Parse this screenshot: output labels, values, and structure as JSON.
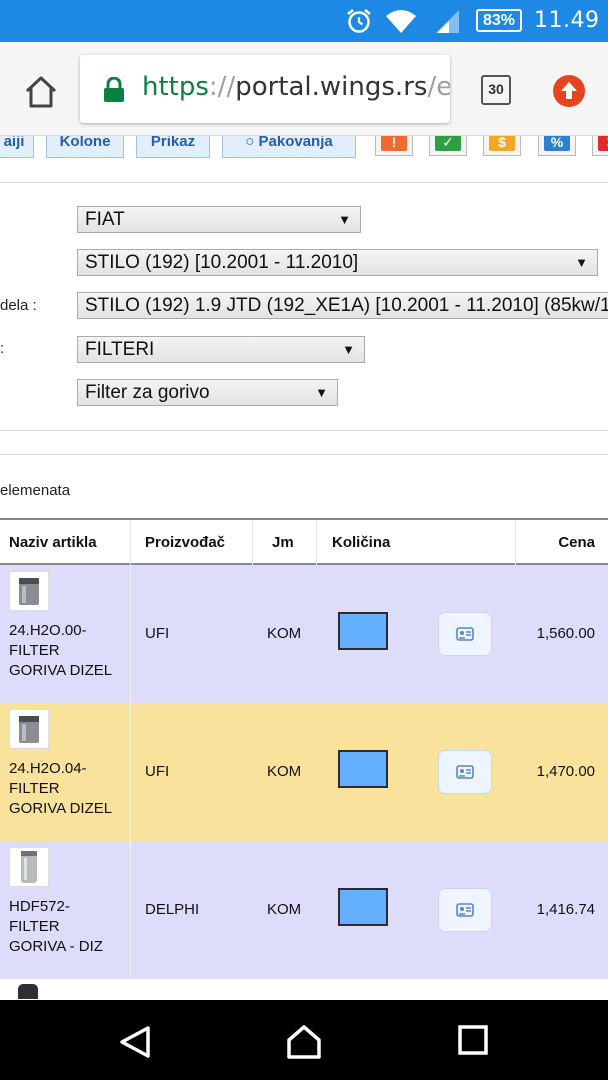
{
  "status_bar": {
    "battery": "83%",
    "time": "11.49",
    "icons": [
      "alarm-icon",
      "wifi-icon",
      "signal-icon",
      "battery-icon"
    ]
  },
  "browser": {
    "url_scheme": "https",
    "url_sep": "://",
    "url_host": "portal.wings.rs",
    "url_path": "/e",
    "tab_count": "30"
  },
  "toolbar": {
    "buttons": [
      "aiji",
      "Kolone",
      "Prikaz",
      "Pakovanja"
    ],
    "icon_buttons": [
      {
        "name": "alert",
        "glyph": "!",
        "color": "#f26a2e"
      },
      {
        "name": "check",
        "glyph": "✓",
        "color": "#2ea043"
      },
      {
        "name": "dollar",
        "glyph": "$",
        "color": "#f5a623"
      },
      {
        "name": "percent",
        "glyph": "%",
        "color": "#2f7fd1"
      },
      {
        "name": "close",
        "glyph": "✕",
        "color": "#e32b2b"
      }
    ]
  },
  "filters": {
    "labels": {
      "model_detail": "dela :",
      "group": ":"
    },
    "brand": "FIAT",
    "model": "STILO (192) [10.2001 - 11.2010]",
    "model_detail": "STILO (192) 1.9 JTD (192_XE1A) [10.2001 - 11.2010] (85kw/1",
    "group": "FILTERI",
    "subgroup": "Filter za gorivo"
  },
  "list": {
    "count_text": "elemenata",
    "headers": {
      "name": "Naziv artikla",
      "manufacturer": "Proizvođač",
      "unit": "Jm",
      "quantity": "Količina",
      "price": "Cena"
    },
    "rows": [
      {
        "name": "24.H2O.00- FILTER GORIVA DIZEL",
        "manufacturer": "UFI",
        "unit": "KOM",
        "price": "1,560.00",
        "bg": "#dedcfb"
      },
      {
        "name": "24.H2O.04- FILTER GORIVA DIZEL",
        "manufacturer": "UFI",
        "unit": "KOM",
        "price": "1,470.00",
        "bg": "#f9e29c"
      },
      {
        "name": "HDF572- FILTER GORIVA - DIZ",
        "manufacturer": "DELPHI",
        "unit": "KOM",
        "price": "1,416.74",
        "bg": "#dedcfb"
      }
    ]
  }
}
